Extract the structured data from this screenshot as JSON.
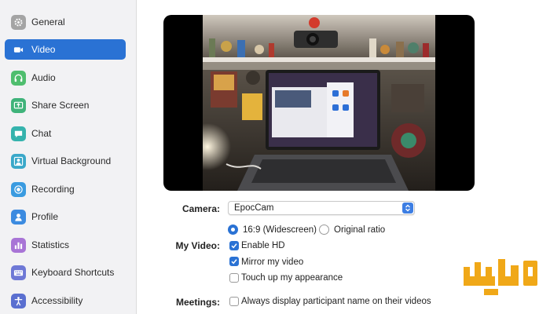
{
  "sidebar": {
    "items": [
      {
        "label": "General",
        "icon": "gear-icon",
        "color": "#9a9a9a",
        "active": false
      },
      {
        "label": "Video",
        "icon": "video-camera-icon",
        "color": "#ffffff",
        "active": true
      },
      {
        "label": "Audio",
        "icon": "headphones-icon",
        "color": "#4fbe6e",
        "active": false
      },
      {
        "label": "Share Screen",
        "icon": "share-screen-icon",
        "color": "#3fb37a",
        "active": false
      },
      {
        "label": "Chat",
        "icon": "chat-bubble-icon",
        "color": "#35b3ad",
        "active": false
      },
      {
        "label": "Virtual Background",
        "icon": "person-background-icon",
        "color": "#3aa8c9",
        "active": false
      },
      {
        "label": "Recording",
        "icon": "record-icon",
        "color": "#3a9be0",
        "active": false
      },
      {
        "label": "Profile",
        "icon": "profile-icon",
        "color": "#3c8be0",
        "active": false
      },
      {
        "label": "Statistics",
        "icon": "bar-chart-icon",
        "color": "#a874d6",
        "active": false
      },
      {
        "label": "Keyboard Shortcuts",
        "icon": "keyboard-icon",
        "color": "#6e78d6",
        "active": false
      },
      {
        "label": "Accessibility",
        "icon": "accessibility-icon",
        "color": "#5a6fd0",
        "active": false
      }
    ]
  },
  "camera": {
    "label": "Camera:",
    "value": "EpocCam"
  },
  "my_video": {
    "label": "My Video:",
    "ratio_widescreen": "16:9 (Widescreen)",
    "ratio_original": "Original ratio",
    "enable_hd": "Enable HD",
    "mirror": "Mirror my video",
    "touch_up": "Touch up my appearance"
  },
  "meetings": {
    "label": "Meetings:",
    "always_display_name": "Always display participant name on their videos"
  },
  "colors": {
    "accent": "#2a72d4",
    "logo": "#f0a818"
  }
}
